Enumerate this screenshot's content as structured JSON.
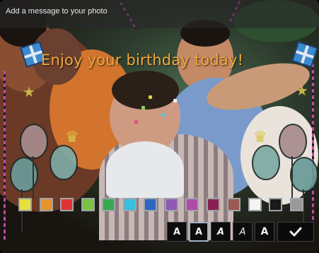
{
  "header": {
    "title": "Add a message to your photo"
  },
  "photo": {
    "message": "Enjoy your birthday today!",
    "message_color": "#f0a93c"
  },
  "palette": {
    "colors": [
      "#e5e03d",
      "#e8932d",
      "#e23234",
      "#7ac242",
      "#3aa850",
      "#35c0df",
      "#2c66c0",
      "#8f58b6",
      "#b04aa8",
      "#8a2050",
      "#9a5a52",
      "#f4f4f4",
      "#1a1a1a",
      "#9a9a9a"
    ]
  },
  "toolbar": {
    "font_buttons": [
      {
        "label": "A",
        "style": "regular"
      },
      {
        "label": "A",
        "style": "regular",
        "selected": true
      },
      {
        "label": "A",
        "style": "italic"
      },
      {
        "label": "A",
        "style": "outlined-italic"
      },
      {
        "label": "A",
        "style": "bold"
      }
    ],
    "confirm_icon": "checkmark-icon"
  }
}
